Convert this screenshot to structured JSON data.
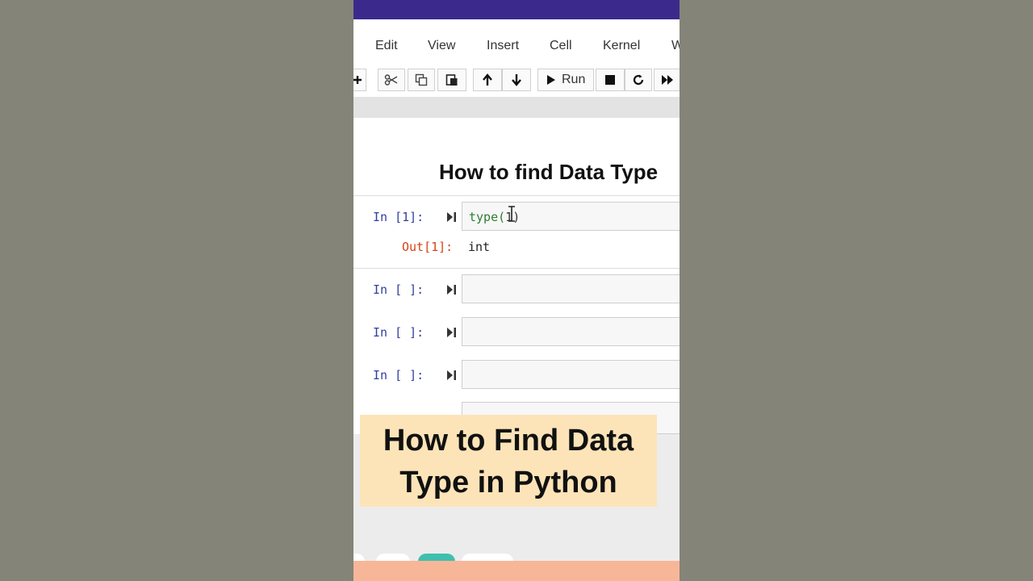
{
  "menu": {
    "items": [
      "Edit",
      "View",
      "Insert",
      "Cell",
      "Kernel",
      "W"
    ]
  },
  "toolbar": {
    "run_label": "Run",
    "icons": [
      "plus-icon",
      "scissors-icon",
      "copy-icon",
      "paste-icon",
      "arrow-up-icon",
      "arrow-down-icon",
      "play-icon",
      "stop-icon",
      "restart-icon",
      "fast-forward-icon"
    ]
  },
  "notebook": {
    "heading": "How to find Data Type",
    "cells": [
      {
        "prompt": "In [1]:",
        "code_fn": "type(",
        "code_arg": "1",
        "code_close": ")",
        "out_prompt": "Out[1]:",
        "output": "int"
      },
      {
        "prompt": "In [ ]:"
      },
      {
        "prompt": "In [ ]:"
      },
      {
        "prompt": "In [ ]:"
      }
    ]
  },
  "caption": {
    "line1": "How to Find Data",
    "line2": "Type in Python"
  },
  "colors": {
    "topbar": "#3b2a8c",
    "caption_bg": "#fde4b8",
    "prompt_in": "#303f9f",
    "prompt_out": "#d84315",
    "code_keyword": "#2e7d32",
    "bottom_strip": "#f8b698"
  }
}
